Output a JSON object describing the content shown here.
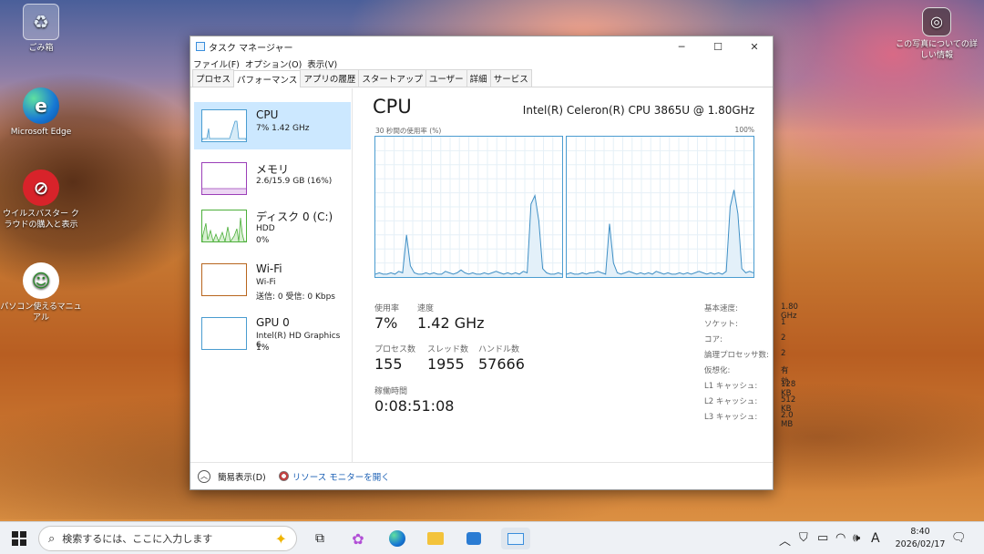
{
  "desktop": {
    "icons": [
      {
        "label": "ごみ箱"
      },
      {
        "label": "Microsoft Edge"
      },
      {
        "label": "ウイルスバスター クラウドの購入と表示"
      },
      {
        "label": "パソコン使えるマニュアル"
      },
      {
        "label": "この写真についての詳しい情報"
      }
    ]
  },
  "window": {
    "title": "タスク マネージャー",
    "menu": [
      "ファイル(F)",
      "オプション(O)",
      "表示(V)"
    ],
    "tabs": [
      "プロセス",
      "パフォーマンス",
      "アプリの履歴",
      "スタートアップ",
      "ユーザー",
      "詳細",
      "サービス"
    ],
    "active_tab": "パフォーマンス"
  },
  "sidebar": {
    "items": [
      {
        "title": "CPU",
        "line1": "7% 1.42 GHz",
        "line2": ""
      },
      {
        "title": "メモリ",
        "line1": "2.6/15.9 GB (16%)",
        "line2": ""
      },
      {
        "title": "ディスク 0 (C:)",
        "line1": "HDD",
        "line2": "0%"
      },
      {
        "title": "Wi-Fi",
        "line1": "Wi-Fi",
        "line2": "送信: 0 受信: 0 Kbps"
      },
      {
        "title": "GPU 0",
        "line1": "Intel(R) HD Graphics 6...",
        "line2": "1%"
      }
    ],
    "colors": {
      "cpu": "#4a9cd0",
      "memory": "#9b3fb8",
      "disk": "#4caf3a",
      "wifi": "#b8651d",
      "gpu": "#4a9cd0"
    }
  },
  "main": {
    "title": "CPU",
    "cpu_name": "Intel(R) Celeron(R) CPU 3865U @ 1.80GHz",
    "graph_label_left": "30 秒間の使用率 (%)",
    "graph_label_right": "100%",
    "stats": {
      "usage_label": "使用率",
      "usage": "7%",
      "speed_label": "速度",
      "speed": "1.42 GHz",
      "processes_label": "プロセス数",
      "processes": "155",
      "threads_label": "スレッド数",
      "threads": "1955",
      "handles_label": "ハンドル数",
      "handles": "57666",
      "uptime_label": "稼働時間",
      "uptime": "0:08:51:08"
    },
    "specs": [
      {
        "label": "基本速度:",
        "value": "1.80 GHz"
      },
      {
        "label": "ソケット:",
        "value": "1"
      },
      {
        "label": "コア:",
        "value": "2"
      },
      {
        "label": "論理プロセッサ数:",
        "value": "2"
      },
      {
        "label": "仮想化:",
        "value": "有効"
      },
      {
        "label": "L1 キャッシュ:",
        "value": "128 KB"
      },
      {
        "label": "L2 キャッシュ:",
        "value": "512 KB"
      },
      {
        "label": "L3 キャッシュ:",
        "value": "2.0 MB"
      }
    ],
    "graph_series": [
      [
        2,
        3,
        2,
        2,
        3,
        2,
        4,
        3,
        30,
        8,
        3,
        2,
        2,
        3,
        2,
        3,
        2,
        2,
        4,
        3,
        2,
        3,
        5,
        3,
        2,
        3,
        2,
        2,
        3,
        2,
        3,
        4,
        3,
        2,
        3,
        2,
        3,
        2,
        4,
        3,
        52,
        58,
        40,
        6,
        3,
        2,
        2,
        3,
        2
      ],
      [
        2,
        3,
        2,
        2,
        3,
        2,
        3,
        3,
        4,
        3,
        2,
        38,
        10,
        3,
        2,
        3,
        4,
        3,
        2,
        3,
        2,
        3,
        2,
        4,
        3,
        2,
        3,
        2,
        2,
        3,
        2,
        3,
        2,
        3,
        4,
        3,
        2,
        3,
        2,
        3,
        2,
        4,
        50,
        62,
        45,
        6,
        3,
        4,
        3
      ]
    ]
  },
  "footer": {
    "fewer_details": "簡易表示(D)",
    "resource_monitor": "リソース モニターを開く"
  },
  "taskbar": {
    "search_placeholder": "検索するには、ここに入力します",
    "tray_lang": "A",
    "time": "8:40",
    "date": "2026/02/17"
  }
}
